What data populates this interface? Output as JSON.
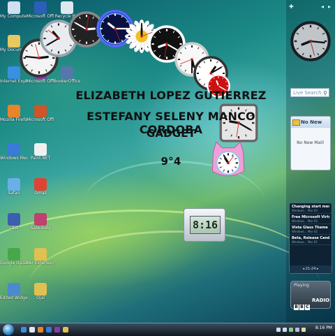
{
  "desktop_icons": [
    {
      "label": "My Computer",
      "color": "#cfe0f0"
    },
    {
      "label": "Microsoft Office Wo...",
      "color": "#2b5fb8"
    },
    {
      "label": "Recycle Bin",
      "color": "#dfe8ee"
    },
    {
      "label": "My Documents",
      "color": "#e8c860"
    },
    {
      "label": "Internet Explorer",
      "color": "#3a8fe0"
    },
    {
      "label": "Microsoft Office Onen...",
      "color": "#8b3aa8"
    },
    {
      "label": "BookerOffice",
      "color": "#5577aa"
    },
    {
      "label": "Mozilla Firefox",
      "color": "#e8842a"
    },
    {
      "label": "Microsoft Office Po...",
      "color": "#d0542a"
    },
    {
      "label": "Windows Media Player",
      "color": "#3a7ad8"
    },
    {
      "label": "Paint.NET",
      "color": "#f0f0f0"
    },
    {
      "label": "Safari",
      "color": "#6ab0e8"
    },
    {
      "label": "Gmail",
      "color": "#dd4433"
    },
    {
      "label": "Ubit",
      "color": "#3a5fb0"
    },
    {
      "label": "Safe-Bold",
      "color": "#c04070"
    },
    {
      "label": "Google Update",
      "color": "#46a84a"
    },
    {
      "label": "Ver Extension ...",
      "color": "#e0c050"
    },
    {
      "label": "Edited Widgets",
      "color": "#4a8ad0"
    },
    {
      "label": "Ojal",
      "color": "#e0c050"
    }
  ],
  "credits": {
    "line1": "ELIZABETH LOPEZ GUTIERREZ",
    "line2": "ESTEFANY SELENY MANCO CORDOBA",
    "line3": "GADGET",
    "line4": "9°4"
  },
  "analog_clocks": [
    {
      "id": "white-classic",
      "face": "#f4f4f4",
      "rim": "#333333",
      "time": "2:46"
    },
    {
      "id": "silver",
      "face": "#e8ecf0",
      "rim": "#9aa5b0",
      "time": "10:40"
    },
    {
      "id": "black-chrono",
      "face": "#222222",
      "rim": "#888888",
      "time": "2:50"
    },
    {
      "id": "blue-neon",
      "face": "#0a1040",
      "rim": "#5566ff",
      "time": "10:15"
    },
    {
      "id": "daisy",
      "face": "#ffffff",
      "rim": "#e6e6e6",
      "time": "12:00"
    },
    {
      "id": "black-white",
      "face": "#111111",
      "rim": "#ffffff",
      "time": "8:20"
    },
    {
      "id": "white-minimal",
      "face": "#f8f8f8",
      "rim": "#cccccc",
      "time": "5:30"
    },
    {
      "id": "white-red",
      "face": "#ffffff",
      "rim": "#333333",
      "time": "1:10"
    },
    {
      "id": "red",
      "face": "#cc1111",
      "rim": "#ffffff",
      "time": "11:20"
    },
    {
      "id": "square-grey",
      "face": "#e6e6e6",
      "rim": "#666666",
      "time": "9:20"
    },
    {
      "id": "pink-cat",
      "face": "#ffffff",
      "rim": "#e890c8",
      "time": "10:55"
    },
    {
      "id": "sidebar-clock",
      "face": "#ffffff",
      "rim": "#222222",
      "time": "8:16"
    }
  ],
  "digital_clock": {
    "time": "8:16"
  },
  "sidebar": {
    "search_placeholder": "Live Search",
    "mail_title": "No New",
    "mail_status": "No New Mail!",
    "feeds": [
      {
        "title": "Changing start menu...",
        "sub": "Windows... Mar 03"
      },
      {
        "title": "Free Microsoft Virtu...",
        "sub": "Windows... Mar 03"
      },
      {
        "title": "Vista Glass Theme",
        "sub": "Windows... Mar 02"
      },
      {
        "title": "Beta, Release Candid...",
        "sub": "Windows... Mar 02"
      }
    ],
    "feed_pager": "21-24",
    "radio_status": "Playing",
    "radio_label": "RADIO",
    "radio_brand": [
      "B",
      "B",
      "C"
    ]
  },
  "taskbar": {
    "clock": "8:16 PM"
  }
}
